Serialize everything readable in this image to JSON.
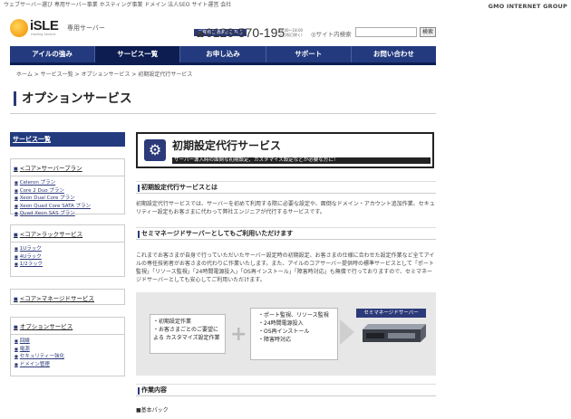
{
  "topbar": {
    "links_text": "ウェブサーバー選び 専用サーバー事業 ホスティング事業 ドメイン 法人SEO サイト運営 会社",
    "group_brand": "GMO INTERNET GROUP"
  },
  "header": {
    "logo_text": "iSLE",
    "logo_sub": "Hosting Service",
    "tagline": "専用サーバー",
    "request_label": "ご資料ご請求はこちら",
    "phone": "0120-570-195",
    "hours_line1": "(9:00～18:00",
    "hours_line2": "土日祝日除く)",
    "search_label": "サイト内検索",
    "search_value": "",
    "search_button": "検索"
  },
  "nav": [
    {
      "label": "アイルの強み"
    },
    {
      "label": "サービス一覧"
    },
    {
      "label": "お申し込み"
    },
    {
      "label": "サポート"
    },
    {
      "label": "お問い合わせ"
    }
  ],
  "breadcrumb": "ホーム > サービス一覧 > オプションサービス > 初期設定代行サービス",
  "page_title": "オプションサービス",
  "sidebar": {
    "top_label": "サービス一覧",
    "plan_head": "<コア>サーバープラン",
    "plan_items": [
      "Celeron プラン",
      "Core 2 Duo プラン",
      "Xeon Dual Core プラン",
      "Xeon Quad Core SATA プラン",
      "Quad Xeon SAS プラン"
    ],
    "rack_head": "<コア>ラックサービス",
    "rack_items": [
      "1Uラック",
      "4Uラック",
      "1/2ラック"
    ],
    "managed_head": "<コア>マネージドサービス",
    "option_head": "オプションサービス",
    "option_items": [
      "回線",
      "電源",
      "セキュリティー強化",
      "ドメイン管理"
    ]
  },
  "main": {
    "banner_title": "初期設定代行サービス",
    "banner_sub": "サーバー導入時の面倒な初期設定、カスタマイズ設定などが必要な方に！",
    "sec1_title": "初期設定代行サービスとは",
    "para1": "初期設定代行サービスでは、サーバーを初めて利用する際に必要な設定や、面倒なドメイン・アカウント追加作業、セキュリティー設定もお客さまに代わって弊社エンジニアが代行するサービスです。",
    "sec2_title": "セミマネージドサーバーとしてもご利用いただけます",
    "para2": "これまでお客さまが自身で行っていただいたサーバー設定時の初期設定、お客さまの仕様に合わせた設定作業など全てアイルの専任技術者がお客さまの代わりに作業いたします。また、アイルのコアサーバー提供時の標準サービスとして「ポート監視」「リソース監視」「24時間電源投入」「OS再インストール」「障害時対応」も無償で行っておりますので、セミマネージドサーバーとしても安心してご利用いただけます。",
    "diagram": {
      "left_items": [
        "初期設定作業",
        "お客さまごとのご要望による カスタマイズ設定作業"
      ],
      "right_items": [
        "ポート監視、リソース監視",
        "24時間電源投入",
        "OS再インストール",
        "障害時対応"
      ],
      "server_label": "セミマネージドサーバー"
    },
    "sec3_title": "作業内容",
    "cutoff_text": "■基本パック"
  }
}
